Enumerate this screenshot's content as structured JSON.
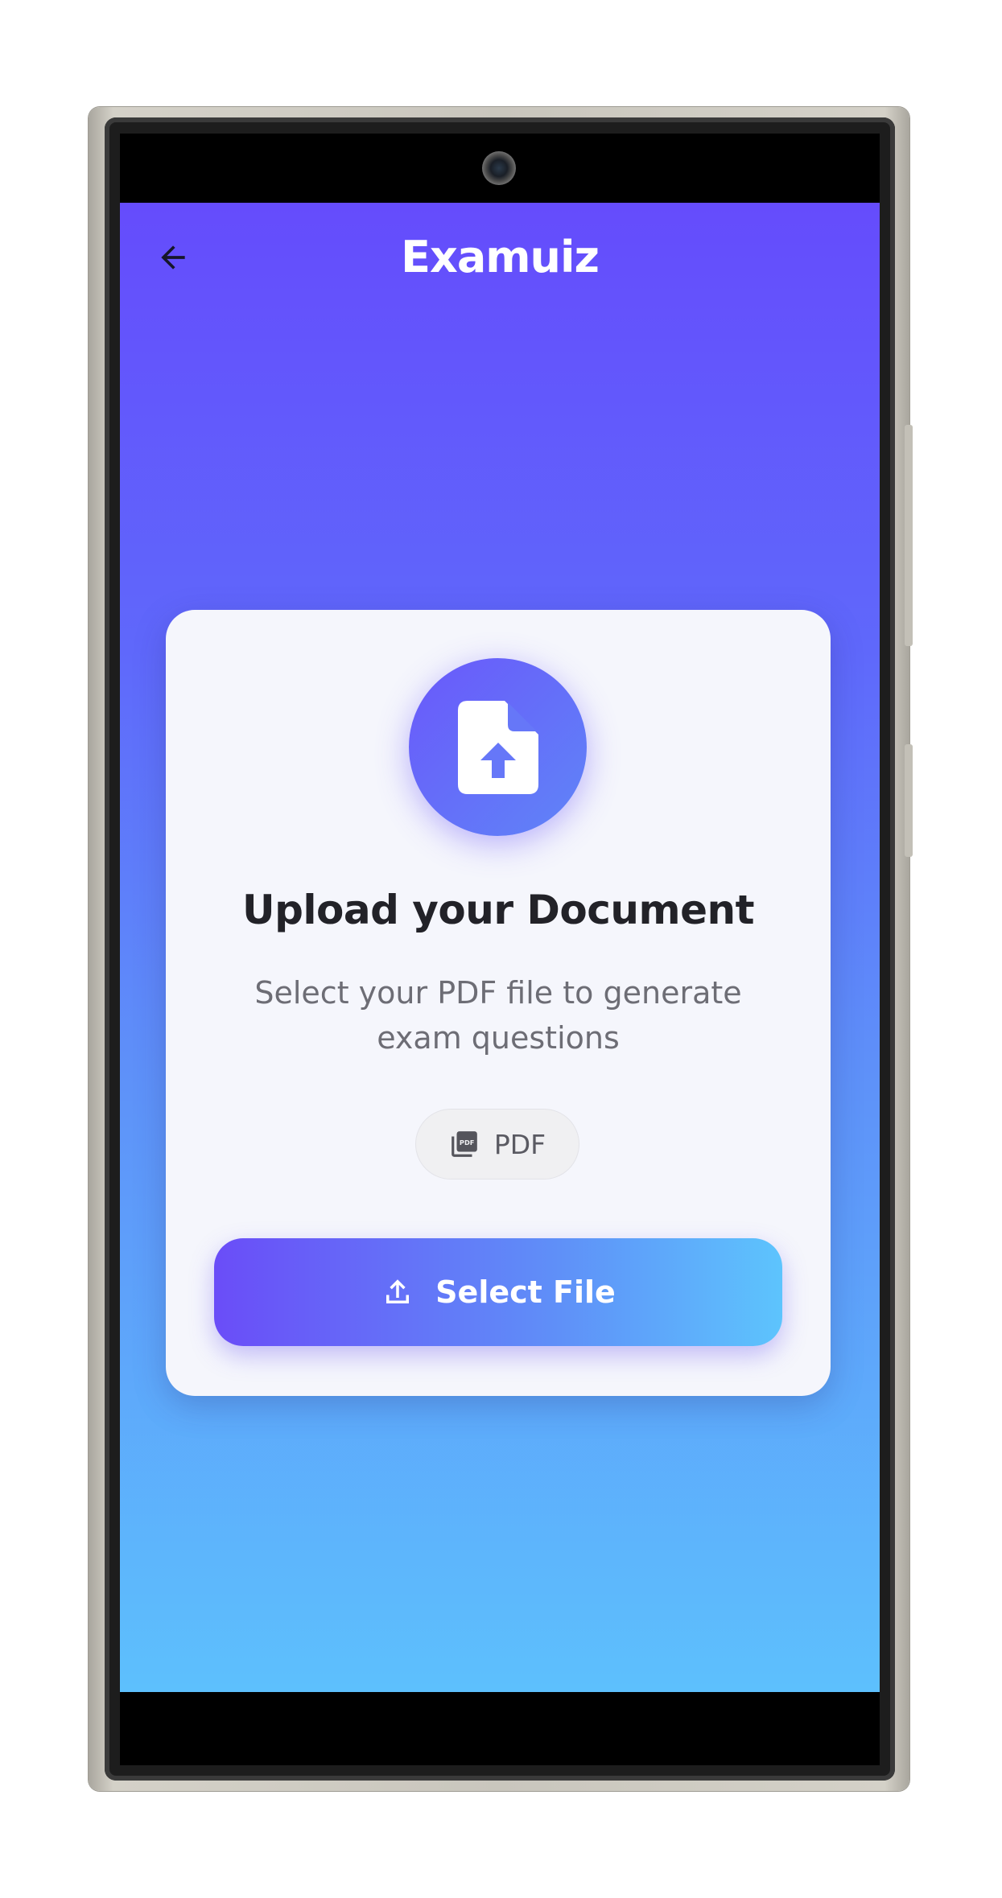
{
  "app": {
    "title": "Examuiz"
  },
  "upload_card": {
    "title": "Upload your Document",
    "subtitle": "Select your PDF file to generate exam questions",
    "file_type_chip": "PDF",
    "select_button_label": "Select File"
  },
  "icons": {
    "back": "arrow-left-icon",
    "upload": "file-upload-icon",
    "pdf": "pdf-icon",
    "select": "upload-icon"
  },
  "colors": {
    "gradient_top": "#654cfc",
    "gradient_bottom": "#5dc0fd",
    "card_background": "#f5f6fc",
    "title_text": "#222228",
    "subtitle_text": "#6d6d75"
  }
}
